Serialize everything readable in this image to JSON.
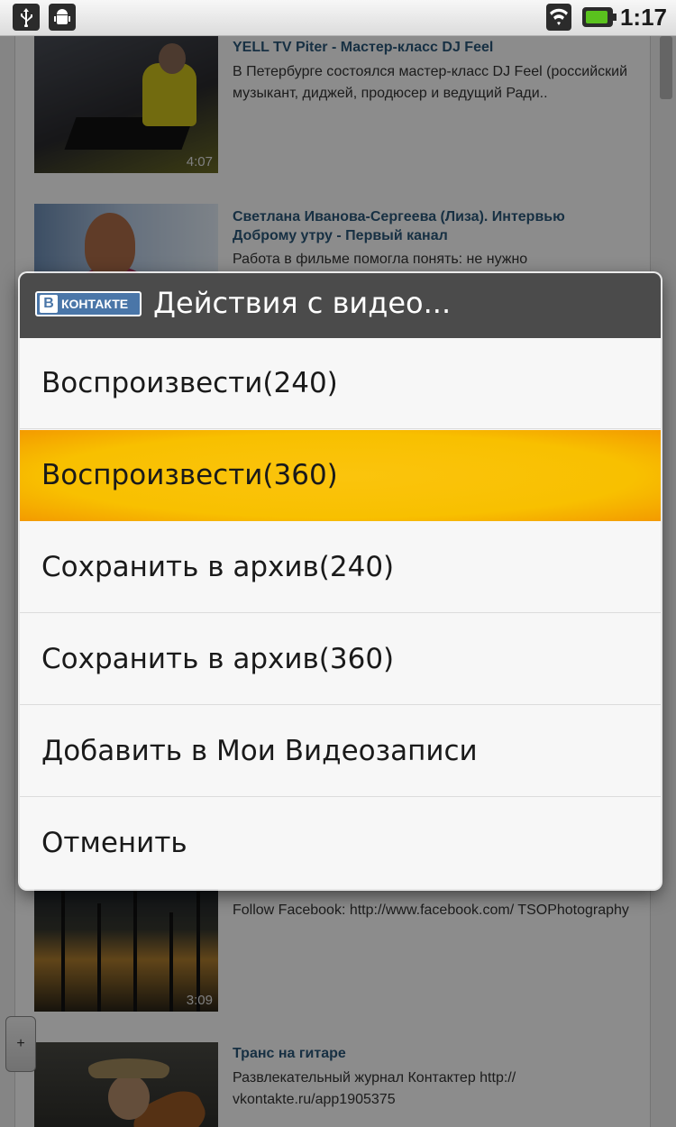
{
  "status_bar": {
    "time": "1:17",
    "icons": [
      "usb-icon",
      "android-debug-icon",
      "wifi-icon",
      "battery-icon"
    ]
  },
  "videos": [
    {
      "title": "YELL TV Piter - Мастер-класс DJ Feel",
      "description": "В Петербурге состоялся мастер-класс DJ Feel (российский музыкант, диджей, продюсер и ведущий Ради..",
      "duration": "4:07"
    },
    {
      "title": "Светлана Иванова-Сергеева (Лиза). Интервью Доброму утру - Первый канал",
      "description": "Работа в фильме помогла понять: не нужно",
      "duration": ""
    },
    {
      "title": "",
      "description": "Follow Facebook: http://www.facebook.com/ TSOPhotography",
      "duration": "3:09"
    },
    {
      "title": "Транс на гитаре",
      "description": "Развлекательный журнал Контактер http:// vkontakte.ru/app1905375",
      "duration": ""
    }
  ],
  "zoom_button": "+",
  "dialog": {
    "logo_text": "КОНТАКТЕ",
    "logo_letter": "В",
    "title": "Действия с видео...",
    "options": [
      "Воспроизвести(240)",
      "Воспроизвести(360)",
      "Сохранить в архив(240)",
      "Сохранить в архив(360)",
      "Добавить в Мои Видеозаписи",
      "Отменить"
    ],
    "selected_index": 1
  },
  "colors": {
    "highlight": "#f8c000",
    "dialog_header": "#4b4b4b",
    "link": "#2b587a",
    "vk_blue": "#4a76a8"
  }
}
